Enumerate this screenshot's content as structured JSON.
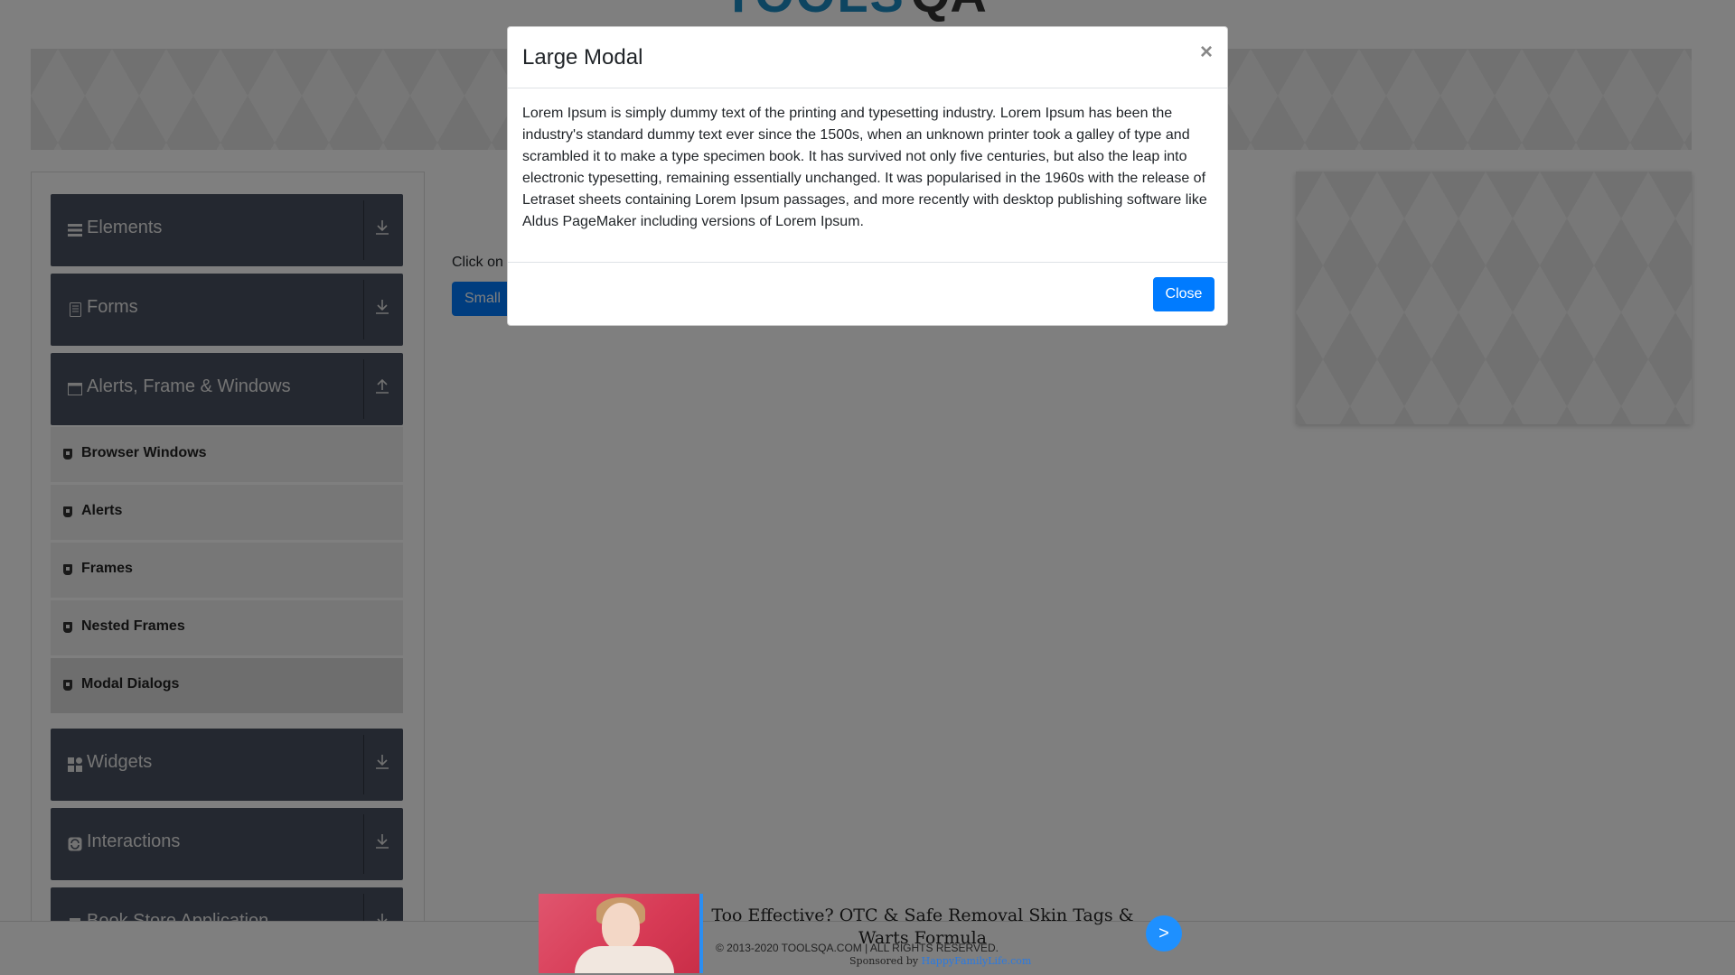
{
  "header": {
    "logo_text": "TOOLS",
    "logo_qa": "QA"
  },
  "sidebar": {
    "groups": [
      {
        "label": "Elements",
        "icon": "hamburger-icon",
        "arrow": "download"
      },
      {
        "label": "Forms",
        "icon": "document-icon",
        "arrow": "download"
      },
      {
        "label": "Alerts, Frame & Windows",
        "icon": "window-icon",
        "arrow": "upload"
      },
      {
        "label": "Widgets",
        "icon": "grid-icon",
        "arrow": "download"
      },
      {
        "label": "Interactions",
        "icon": "refresh-icon",
        "arrow": "download"
      },
      {
        "label": "Book Store Application",
        "icon": "book-icon",
        "arrow": "download"
      }
    ],
    "sub_items": [
      {
        "label": "Browser Windows"
      },
      {
        "label": "Alerts"
      },
      {
        "label": "Frames"
      },
      {
        "label": "Nested Frames"
      },
      {
        "label": "Modal Dialogs",
        "active": true
      }
    ]
  },
  "main": {
    "instruction": "Click on",
    "small_modal_button": "Small"
  },
  "modal": {
    "title": "Large Modal",
    "close_x": "×",
    "body": "Lorem Ipsum is simply dummy text of the printing and typesetting industry. Lorem Ipsum has been the industry's standard dummy text ever since the 1500s, when an unknown printer took a galley of type and scrambled it to make a type specimen book. It has survived not only five centuries, but also the leap into electronic typesetting, remaining essentially unchanged. It was popularised in the 1960s with the release of Letraset sheets containing Lorem Ipsum passages, and more recently with desktop publishing software like Aldus PageMaker including versions of Lorem Ipsum.",
    "close_button": "Close"
  },
  "ad": {
    "headline": "Too Effective? OTC & Safe Removal Skin Tags & Warts Formula",
    "next": ">",
    "sponsored_label": "Sponsored by",
    "sponsor": "HappyFamilyLife.com"
  },
  "footer": {
    "copyright": "© 2013-2020 TOOLSQA.COM | ALL RIGHTS RESERVED."
  },
  "colors": {
    "primary": "#007bff",
    "sidebar_header": "#495160",
    "overlay": "rgba(0,0,0,0.5)"
  }
}
